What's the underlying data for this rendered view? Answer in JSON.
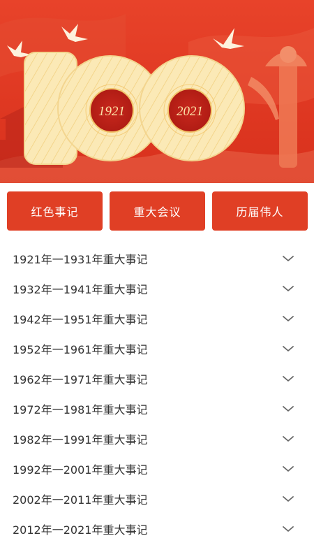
{
  "banner": {
    "year_start": "1921",
    "year_end": "2021",
    "colors": {
      "primary_red": "#dc3420",
      "cream": "#fbe9b6",
      "gold": "#f2c46a"
    }
  },
  "tabs": [
    {
      "label": "红色事记"
    },
    {
      "label": "重大会议"
    },
    {
      "label": "历届伟人"
    }
  ],
  "events": [
    {
      "label": "1921年一1931年重大事记",
      "icon": "chevron-down-icon"
    },
    {
      "label": "1932年一1941年重大事记",
      "icon": "chevron-down-icon"
    },
    {
      "label": "1942年一1951年重大事记",
      "icon": "chevron-down-icon"
    },
    {
      "label": "1952年一1961年重大事记",
      "icon": "chevron-down-icon"
    },
    {
      "label": "1962年一1971年重大事记",
      "icon": "chevron-down-icon"
    },
    {
      "label": "1972年一1981年重大事记",
      "icon": "chevron-down-icon"
    },
    {
      "label": "1982年一1991年重大事记",
      "icon": "chevron-down-icon"
    },
    {
      "label": "1992年一2001年重大事记",
      "icon": "chevron-down-icon"
    },
    {
      "label": "2002年一2011年重大事记",
      "icon": "chevron-down-icon"
    },
    {
      "label": "2012年一2021年重大事记",
      "icon": "chevron-down-icon"
    }
  ]
}
